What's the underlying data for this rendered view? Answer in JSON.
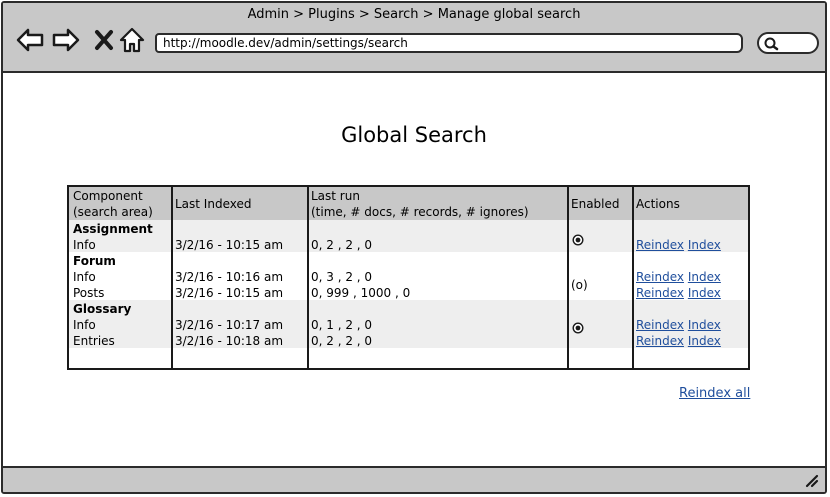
{
  "browser": {
    "title": "Admin > Plugins > Search > Manage global search",
    "url": "http://moodle.dev/admin/settings/search",
    "icons": [
      "back-arrow-icon",
      "forward-arrow-icon",
      "close-x-icon",
      "home-icon",
      "search-icon",
      "resize-grip-icon"
    ]
  },
  "page": {
    "title": "Global Search"
  },
  "table": {
    "headers": {
      "component_line1": "Component",
      "component_line2": "(search area)",
      "last_indexed": "Last Indexed",
      "last_run_line1": "Last run",
      "last_run_line2": "(time, # docs, # records, # ignores)",
      "enabled": "Enabled",
      "actions": "Actions"
    },
    "groups": [
      {
        "name": "Assignment",
        "enabled_glyph": "",
        "rows": [
          {
            "area": "Info",
            "last_indexed": "3/2/16 - 10:15 am",
            "last_run": "0, 2 , 2 , 0",
            "reindex": "Reindex",
            "index": "Index"
          }
        ]
      },
      {
        "name": "Forum",
        "enabled_glyph": "(o)",
        "rows": [
          {
            "area": "Info",
            "last_indexed": "3/2/16 - 10:16 am",
            "last_run": "0, 3 , 2 , 0",
            "reindex": "Reindex",
            "index": "Index"
          },
          {
            "area": "Posts",
            "last_indexed": "3/2/16 - 10:15 am",
            "last_run": "0, 999 , 1000 , 0",
            "reindex": "Reindex",
            "index": "Index"
          }
        ]
      },
      {
        "name": "Glossary",
        "enabled_glyph": "",
        "rows": [
          {
            "area": "Info",
            "last_indexed": "3/2/16 - 10:17 am",
            "last_run": "0, 1 , 2 , 0",
            "reindex": "Reindex",
            "index": "Index"
          },
          {
            "area": "Entries",
            "last_indexed": "3/2/16 - 10:18 am",
            "last_run": "0, 2 , 2 , 0",
            "reindex": "Reindex",
            "index": "Index"
          }
        ]
      }
    ]
  },
  "footer": {
    "reindex_all": "Reindex all"
  },
  "colors": {
    "chrome": "#c8c8c8",
    "row_shade": "#eeeeee",
    "link": "#1f4e9c",
    "border": "#1a1a1a"
  }
}
